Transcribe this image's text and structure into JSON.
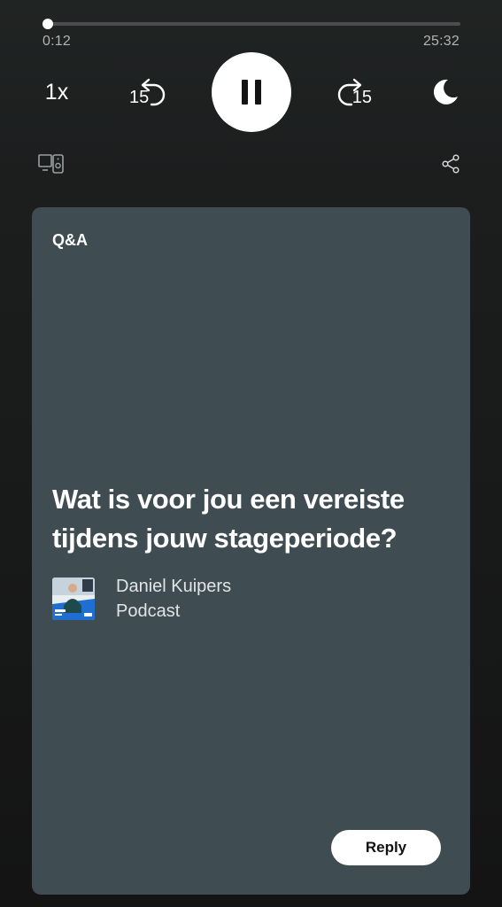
{
  "player": {
    "progress": 0.008,
    "elapsed": "0:12",
    "total": "25:32",
    "speed_label": "1x",
    "skip_back_label": "15",
    "skip_forward_label": "15",
    "state": "playing",
    "icons": {
      "pause": "pause-icon",
      "skip_back": "skip-back-15-icon",
      "skip_forward": "skip-forward-15-icon",
      "sleep": "moon-icon",
      "devices": "devices-icon",
      "share": "share-icon"
    }
  },
  "card": {
    "label": "Q&A",
    "question": "Wat is voor jou een vereiste tijdens jouw stageperiode?",
    "show_name_line1": "Daniel Kuipers",
    "show_name_line2": "Podcast",
    "reply_label": "Reply"
  },
  "colors": {
    "card_background": "#3f4c52",
    "page_background": "#161616",
    "accent": "#ffffff"
  }
}
